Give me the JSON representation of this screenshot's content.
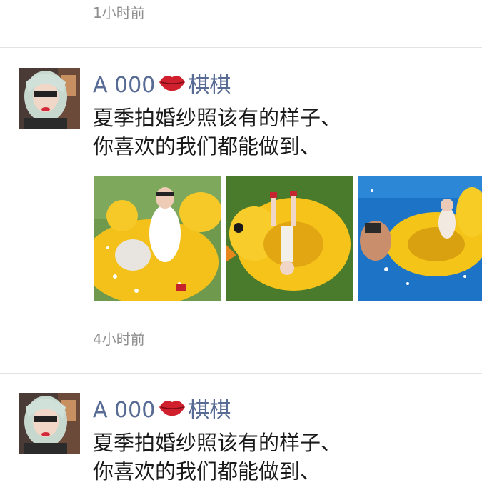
{
  "feed": {
    "top_time": "1小时前",
    "posts": [
      {
        "name_prefix": "A 000",
        "name_suffix": "棋棋",
        "content_line1": "夏季拍婚纱照该有的样子、",
        "content_line2": "你喜欢的我们都能做到、",
        "time": "4小时前"
      },
      {
        "name_prefix": "A 000",
        "name_suffix": "棋棋",
        "content_line1": "夏季拍婚纱照该有的样子、",
        "content_line2": "你喜欢的我们都能做到、"
      }
    ]
  },
  "icons": {
    "name_emoji": "lips-icon"
  },
  "colors": {
    "name": "#576b95",
    "time": "#8f8f8f",
    "text": "#1a1a1a",
    "divider": "#e3e3e3"
  }
}
